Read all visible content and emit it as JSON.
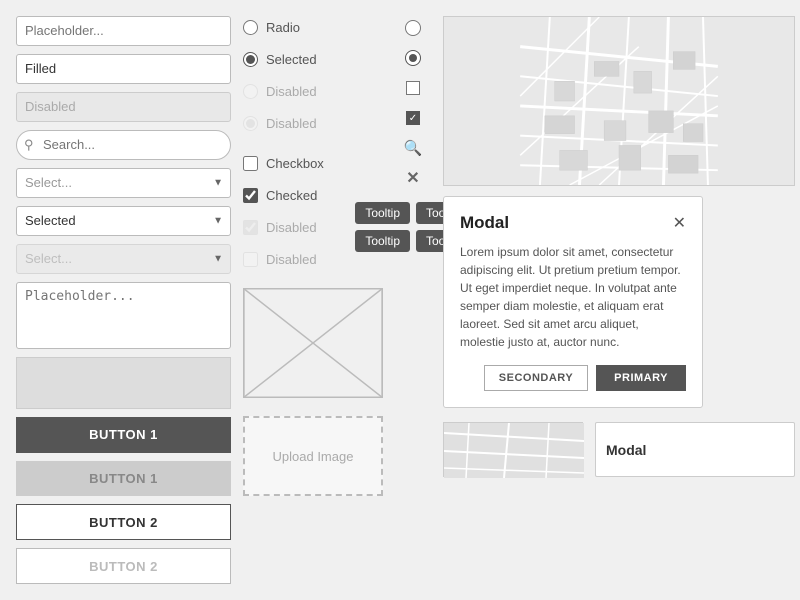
{
  "left": {
    "placeholder_input": "Placeholder...",
    "filled_input": "Filled",
    "disabled_input": "Disabled",
    "search_placeholder": "Search...",
    "select_placeholder": "Select...",
    "select_selected": "Selected",
    "select_disabled": "Select...",
    "textarea_placeholder": "Placeholder...",
    "btn1_primary": "BUTTON 1",
    "btn1_disabled": "BUTTON 1",
    "btn2_outline": "BUTTON 2",
    "btn2_disabled": "BUTTON 2"
  },
  "radios": [
    {
      "label": "Radio",
      "state": "normal"
    },
    {
      "label": "Selected",
      "state": "selected"
    },
    {
      "label": "Disabled",
      "state": "disabled"
    },
    {
      "label": "Disabled",
      "state": "disabled_selected"
    }
  ],
  "checkboxes": [
    {
      "label": "Checkbox",
      "state": "normal"
    },
    {
      "label": "Checked",
      "state": "checked"
    },
    {
      "label": "Disabled",
      "state": "disabled_checked"
    },
    {
      "label": "Disabled",
      "state": "disabled"
    }
  ],
  "icons": [
    "radio-empty",
    "radio-filled",
    "checkbox-empty",
    "checkbox-checked",
    "search",
    "x"
  ],
  "tooltips": [
    "Tooltip",
    "Tooltip",
    "Tooltip",
    "Tooltip"
  ],
  "modal": {
    "title": "Modal",
    "body": "Lorem ipsum dolor sit amet, consectetur adipiscing elit. Ut pretium pretium tempor. Ut eget imperdiet neque. In volutpat ante semper diam molestie, et aliquam erat laoreet. Sed sit amet arcu aliquet, molestie justo at, auctor nunc.",
    "btn_secondary": "SECONDARY",
    "btn_primary": "PRIMARY"
  },
  "upload": {
    "label": "Upload Image"
  }
}
